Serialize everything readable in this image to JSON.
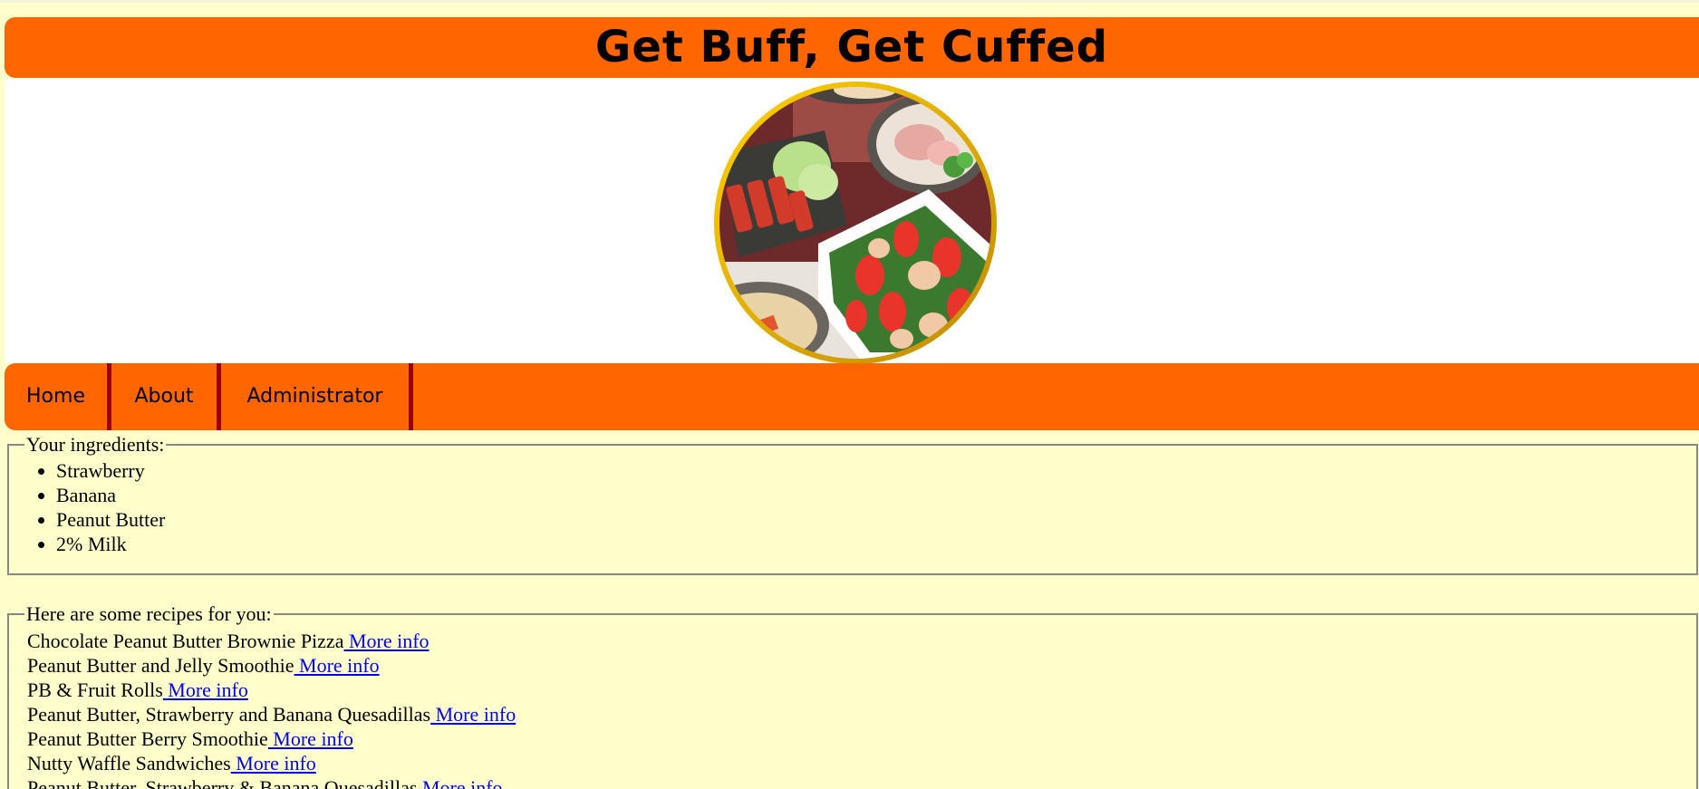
{
  "site": {
    "title": "Get Buff, Get Cuffed"
  },
  "nav": {
    "items": [
      {
        "label": "Home"
      },
      {
        "label": "About"
      },
      {
        "label": "Administrator"
      }
    ]
  },
  "ingredients": {
    "legend": "Your ingredients:",
    "items": [
      "Strawberry",
      "Banana",
      "Peanut Butter",
      "2% Milk"
    ]
  },
  "recipes": {
    "legend": "Here are some recipes for you:",
    "link_label": " More info",
    "items": [
      {
        "name": "Chocolate Peanut Butter Brownie Pizza"
      },
      {
        "name": "Peanut Butter and Jelly Smoothie"
      },
      {
        "name": "PB & Fruit Rolls"
      },
      {
        "name": "Peanut Butter, Strawberry and Banana Quesadillas"
      },
      {
        "name": "Peanut Butter Berry Smoothie"
      },
      {
        "name": "Nutty Waffle Sandwiches"
      },
      {
        "name": "Peanut Butter, Strawberry & Banana Quesadillas"
      }
    ]
  },
  "colors": {
    "page_bg": "#ffffcc",
    "header_bg": "#ff6600",
    "nav_divider": "#990000",
    "link": "#0000ee",
    "plate_rim": "#f2c200"
  },
  "icons": {
    "banner_image": "food-plate-image"
  }
}
